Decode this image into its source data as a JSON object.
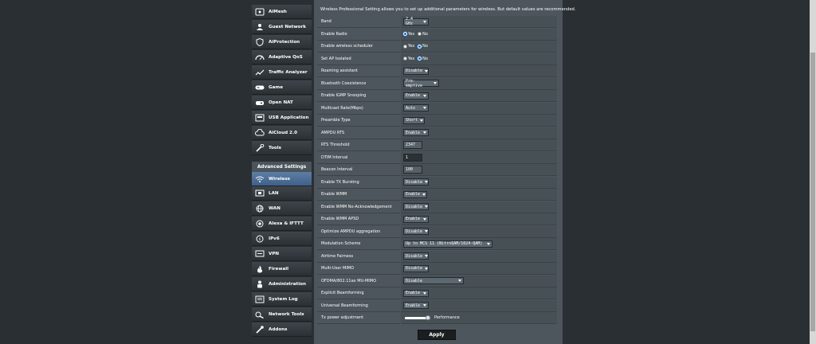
{
  "sidebar": {
    "items": [
      {
        "label": "AiMesh",
        "icon": "aimesh-icon"
      },
      {
        "label": "Guest Network",
        "icon": "guest-network-icon"
      },
      {
        "label": "AiProtection",
        "icon": "shield-icon"
      },
      {
        "label": "Adaptive QoS",
        "icon": "qos-gauge-icon"
      },
      {
        "label": "Traffic Analyzer",
        "icon": "traffic-chart-icon"
      },
      {
        "label": "Game",
        "icon": "gamepad-icon"
      },
      {
        "label": "Open NAT",
        "icon": "open-nat-icon"
      },
      {
        "label": "USB Application",
        "icon": "usb-icon"
      },
      {
        "label": "AiCloud 2.0",
        "icon": "cloud-icon"
      },
      {
        "label": "Tools",
        "icon": "wrench-icon"
      }
    ],
    "advanced_header": "Advanced Settings",
    "advanced_items": [
      {
        "label": "Wireless",
        "icon": "wifi-icon",
        "active": true
      },
      {
        "label": "LAN",
        "icon": "lan-icon"
      },
      {
        "label": "WAN",
        "icon": "globe-icon"
      },
      {
        "label": "Alexa & IFTTT",
        "icon": "alexa-icon"
      },
      {
        "label": "IPv6",
        "icon": "ipv6-icon"
      },
      {
        "label": "VPN",
        "icon": "vpn-icon"
      },
      {
        "label": "Firewall",
        "icon": "firewall-icon"
      },
      {
        "label": "Administration",
        "icon": "admin-person-icon"
      },
      {
        "label": "System Log",
        "icon": "system-log-icon"
      },
      {
        "label": "Network Tools",
        "icon": "network-tools-icon"
      },
      {
        "label": "Addons",
        "icon": "addons-icon"
      }
    ]
  },
  "main": {
    "description": "Wireless Professional Setting allows you to set up additional parameters for wireless. But default values are recommended.",
    "rows": [
      {
        "label": "Band",
        "type": "select",
        "value": "2.4 GHz"
      },
      {
        "label": "Enable Radio",
        "type": "radio",
        "options": [
          "Yes",
          "No"
        ],
        "selected": 0
      },
      {
        "label": "Enable wireless scheduler",
        "type": "radio",
        "options": [
          "Yes",
          "No"
        ],
        "selected": 1
      },
      {
        "label": "Set AP Isolated",
        "type": "radio",
        "options": [
          "Yes",
          "No"
        ],
        "selected": 1
      },
      {
        "label": "Roaming assistant",
        "type": "select",
        "value": "Disable"
      },
      {
        "label": "Bluetooth Coexistence",
        "type": "select",
        "value": "Pre-emptive"
      },
      {
        "label": "Enable IGMP Snooping",
        "type": "select",
        "value": "Enable"
      },
      {
        "label": "Multicast Rate(Mbps)",
        "type": "select",
        "value": "Auto"
      },
      {
        "label": "Preamble Type",
        "type": "select",
        "value": "Short"
      },
      {
        "label": "AMPDU RTS",
        "type": "select",
        "value": "Enable"
      },
      {
        "label": "RTS Threshold",
        "type": "text",
        "value": "2347"
      },
      {
        "label": "DTIM Interval",
        "type": "text",
        "value": "1"
      },
      {
        "label": "Beacon Interval",
        "type": "text",
        "value": "100"
      },
      {
        "label": "Enable TX Bursting",
        "type": "select",
        "value": "Disable"
      },
      {
        "label": "Enable WMM",
        "type": "select",
        "value": "Enable"
      },
      {
        "label": "Enable WMM No-Acknowledgement",
        "type": "select",
        "value": "Disable"
      },
      {
        "label": "Enable WMM APSD",
        "type": "select",
        "value": "Enable"
      },
      {
        "label": "Optimize AMPDU aggregation",
        "type": "select",
        "value": "Disable"
      },
      {
        "label": "Modulation Scheme",
        "type": "select",
        "value": "Up to MCS 11 (NitroQAM/1024-QAM)"
      },
      {
        "label": "Airtime Fairness",
        "type": "select",
        "value": "Disable"
      },
      {
        "label": "Multi-User MIMO",
        "type": "select",
        "value": "Disable"
      },
      {
        "label": "OFDMA/802.11ax MU-MIMO",
        "type": "select",
        "value": "Disable"
      },
      {
        "label": "Explicit Beamforming",
        "type": "select",
        "value": "Enable"
      },
      {
        "label": "Universal Beamforming",
        "type": "select",
        "value": "Enable"
      },
      {
        "label": "Tx power adjustment",
        "type": "slider",
        "level_percent": 100,
        "value_label": "Performance"
      }
    ],
    "apply_label": "Apply"
  }
}
